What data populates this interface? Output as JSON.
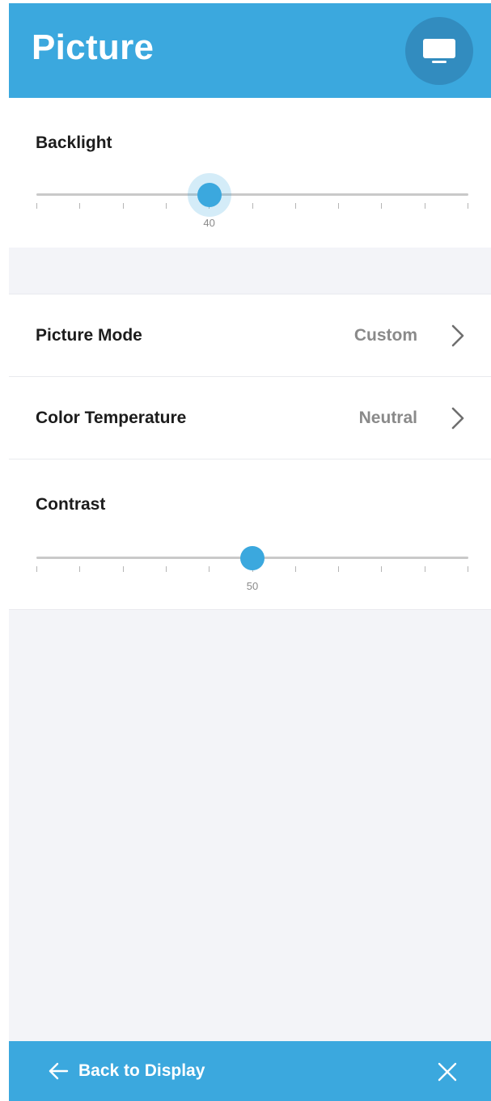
{
  "header": {
    "title": "Picture",
    "icon": "monitor-icon",
    "accent_color": "#3ba8de"
  },
  "backlight": {
    "label": "Backlight",
    "value": 40,
    "value_label": "40",
    "min": 0,
    "max": 100,
    "focused": true
  },
  "picture_mode": {
    "label": "Picture Mode",
    "value": "Custom",
    "icon": "chevron-right-icon"
  },
  "color_temperature": {
    "label": "Color Temperature",
    "value": "Neutral",
    "icon": "chevron-right-icon"
  },
  "contrast": {
    "label": "Contrast",
    "value": 50,
    "value_label": "50",
    "min": 0,
    "max": 100,
    "focused": false
  },
  "footer": {
    "back_label": "Back to Display",
    "back_icon": "arrow-left-icon",
    "close_icon": "close-icon"
  }
}
